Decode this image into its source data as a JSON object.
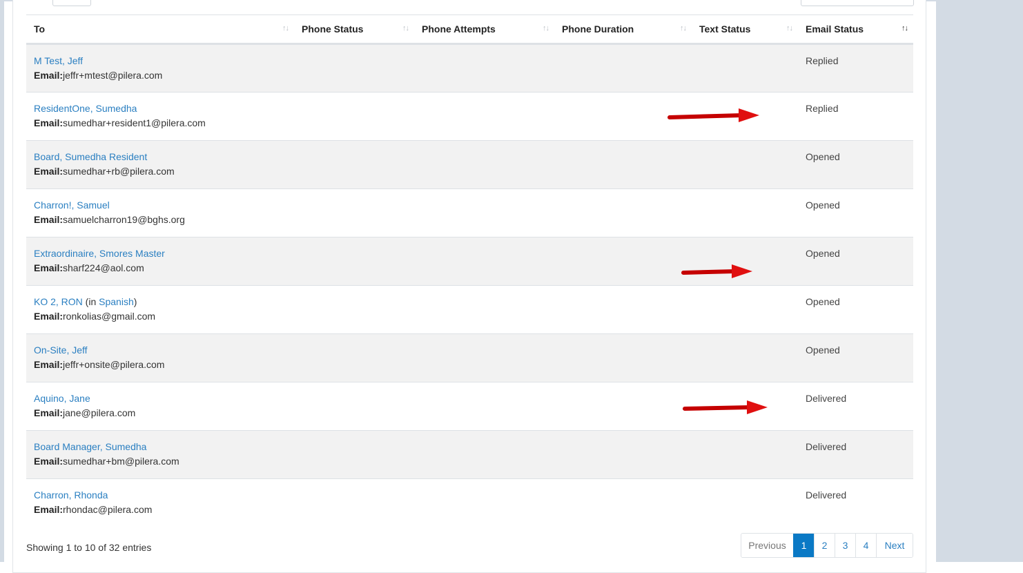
{
  "table": {
    "columns": [
      {
        "label": "To"
      },
      {
        "label": "Phone Status"
      },
      {
        "label": "Phone Attempts"
      },
      {
        "label": "Phone Duration"
      },
      {
        "label": "Text Status"
      },
      {
        "label": "Email Status"
      }
    ],
    "email_label": "Email:",
    "rows": [
      {
        "name": "M Test, Jeff",
        "email": "jeffr+mtest@pilera.com",
        "email_status": "Replied"
      },
      {
        "name": "ResidentOne, Sumedha",
        "email": "sumedhar+resident1@pilera.com",
        "email_status": "Replied"
      },
      {
        "name": "Board, Sumedha Resident",
        "email": "sumedhar+rb@pilera.com",
        "email_status": "Opened"
      },
      {
        "name": "Charron!, Samuel",
        "email": "samuelcharron19@bghs.org",
        "email_status": "Opened"
      },
      {
        "name": "Extraordinaire, Smores Master",
        "email": "sharf224@aol.com",
        "email_status": "Opened"
      },
      {
        "name": "KO 2, RON",
        "note_prefix": " (in ",
        "language": "Spanish",
        "note_suffix": ")",
        "email": "ronkolias@gmail.com",
        "email_status": "Opened"
      },
      {
        "name": "On-Site, Jeff",
        "email": "jeffr+onsite@pilera.com",
        "email_status": "Opened"
      },
      {
        "name": "Aquino, Jane",
        "email": "jane@pilera.com",
        "email_status": "Delivered"
      },
      {
        "name": "Board Manager, Sumedha",
        "email": "sumedhar+bm@pilera.com",
        "email_status": "Delivered"
      },
      {
        "name": "Charron, Rhonda",
        "email": "rhondac@pilera.com",
        "email_status": "Delivered"
      }
    ]
  },
  "footer": {
    "info": "Showing 1 to 10 of 32 entries",
    "pagination": {
      "previous": "Previous",
      "pages": [
        "1",
        "2",
        "3",
        "4"
      ],
      "current": "1",
      "next": "Next"
    }
  },
  "colors": {
    "link": "#2a7fc1",
    "active_page": "#0a79c5",
    "annotation_arrow": "#e01010",
    "row_stripe": "#f2f2f2"
  }
}
